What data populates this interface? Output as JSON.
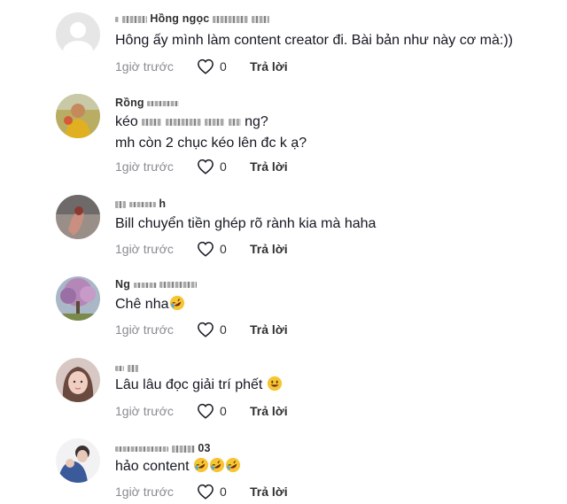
{
  "comments": [
    {
      "username": "Hồng ngọc",
      "lines": [
        "Hông ấy mình làm content creator đi. Bài bản như này cơ mà:))"
      ],
      "time": "1giờ trước",
      "likes": "0",
      "reply": "Trả lời"
    },
    {
      "username": "Rồng",
      "lines": [
        "kéo",
        "ng?",
        "mh còn 2 chục kéo lên đc k ạ?"
      ],
      "time": "1giờ trước",
      "likes": "0",
      "reply": "Trả lời"
    },
    {
      "username": "h",
      "lines": [
        "Bill chuyển tiền ghép rõ rành kia mà haha"
      ],
      "time": "1giờ trước",
      "likes": "0",
      "reply": "Trả lời"
    },
    {
      "username": "Ng",
      "lines": [
        "Chê nha"
      ],
      "time": "1giờ trước",
      "likes": "0",
      "reply": "Trả lời"
    },
    {
      "username": "",
      "lines": [
        "Lâu lâu đọc giải trí phết"
      ],
      "time": "1giờ trước",
      "likes": "0",
      "reply": "Trả lời"
    },
    {
      "username": "03",
      "lines": [
        "hảo content"
      ],
      "time": "1giờ trước",
      "likes": "0",
      "reply": "Trả lời"
    }
  ],
  "icons": {
    "like": "heart-outline-icon",
    "laugh": "rofl-emoji-icon",
    "smile": "smile-emoji-icon"
  },
  "colors": {
    "text": "#161823",
    "meta": "#8a8b91",
    "icon": "#161823"
  }
}
